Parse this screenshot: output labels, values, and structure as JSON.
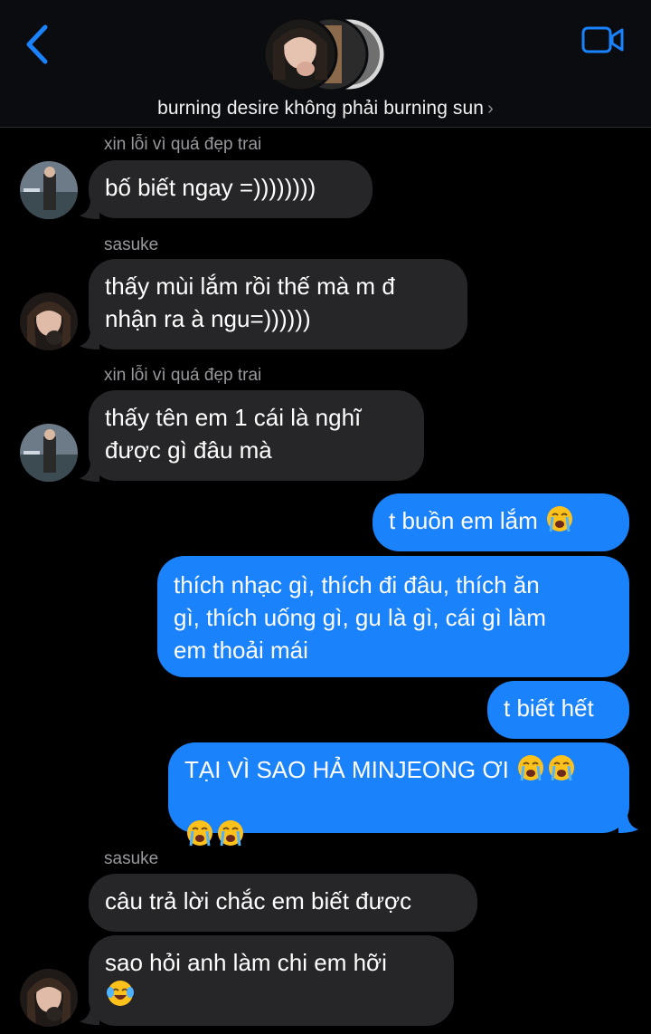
{
  "header": {
    "title": "burning desire không phải burning sun",
    "chevron": "›",
    "accent_color": "#1a82fb"
  },
  "contacts": {
    "a": "xin lỗi vì quá đẹp trai",
    "b": "sasuke"
  },
  "messages": [
    {
      "from": "in",
      "sender": "xin lỗi vì quá đẹp trai",
      "text": "bố biết ngay =))))))))"
    },
    {
      "from": "in",
      "sender": "sasuke",
      "text": "thấy mùi lắm rồi thế mà m đ\nnhận ra à ngu=))))))"
    },
    {
      "from": "in",
      "sender": "xin lỗi vì quá đẹp trai",
      "text": "thấy tên em 1 cái là nghĩ\nđược gì đâu mà"
    },
    {
      "from": "out",
      "text": "t buồn em lắm",
      "emoji": "loudly-crying-face"
    },
    {
      "from": "out",
      "text": "thích nhạc gì, thích đi đâu, thích ăn\ngì, thích uống gì, gu là gì, cái gì làm\nem thoải mái"
    },
    {
      "from": "out",
      "text": "t biết hết"
    },
    {
      "from": "out",
      "text": "TẠI VÌ SAO HẢ MINJEONG ƠI",
      "emoji": "loudly-crying-face x4"
    },
    {
      "from": "in",
      "sender": "sasuke",
      "text": "câu trả lời chắc em biết được"
    },
    {
      "from": "in",
      "text": "sao hỏi anh làm chi em hỡi",
      "emoji": "face-with-tears-of-joy"
    }
  ],
  "colors": {
    "incoming_bubble": "#262629",
    "outgoing_bubble": "#1a82fb",
    "background": "#000000"
  }
}
